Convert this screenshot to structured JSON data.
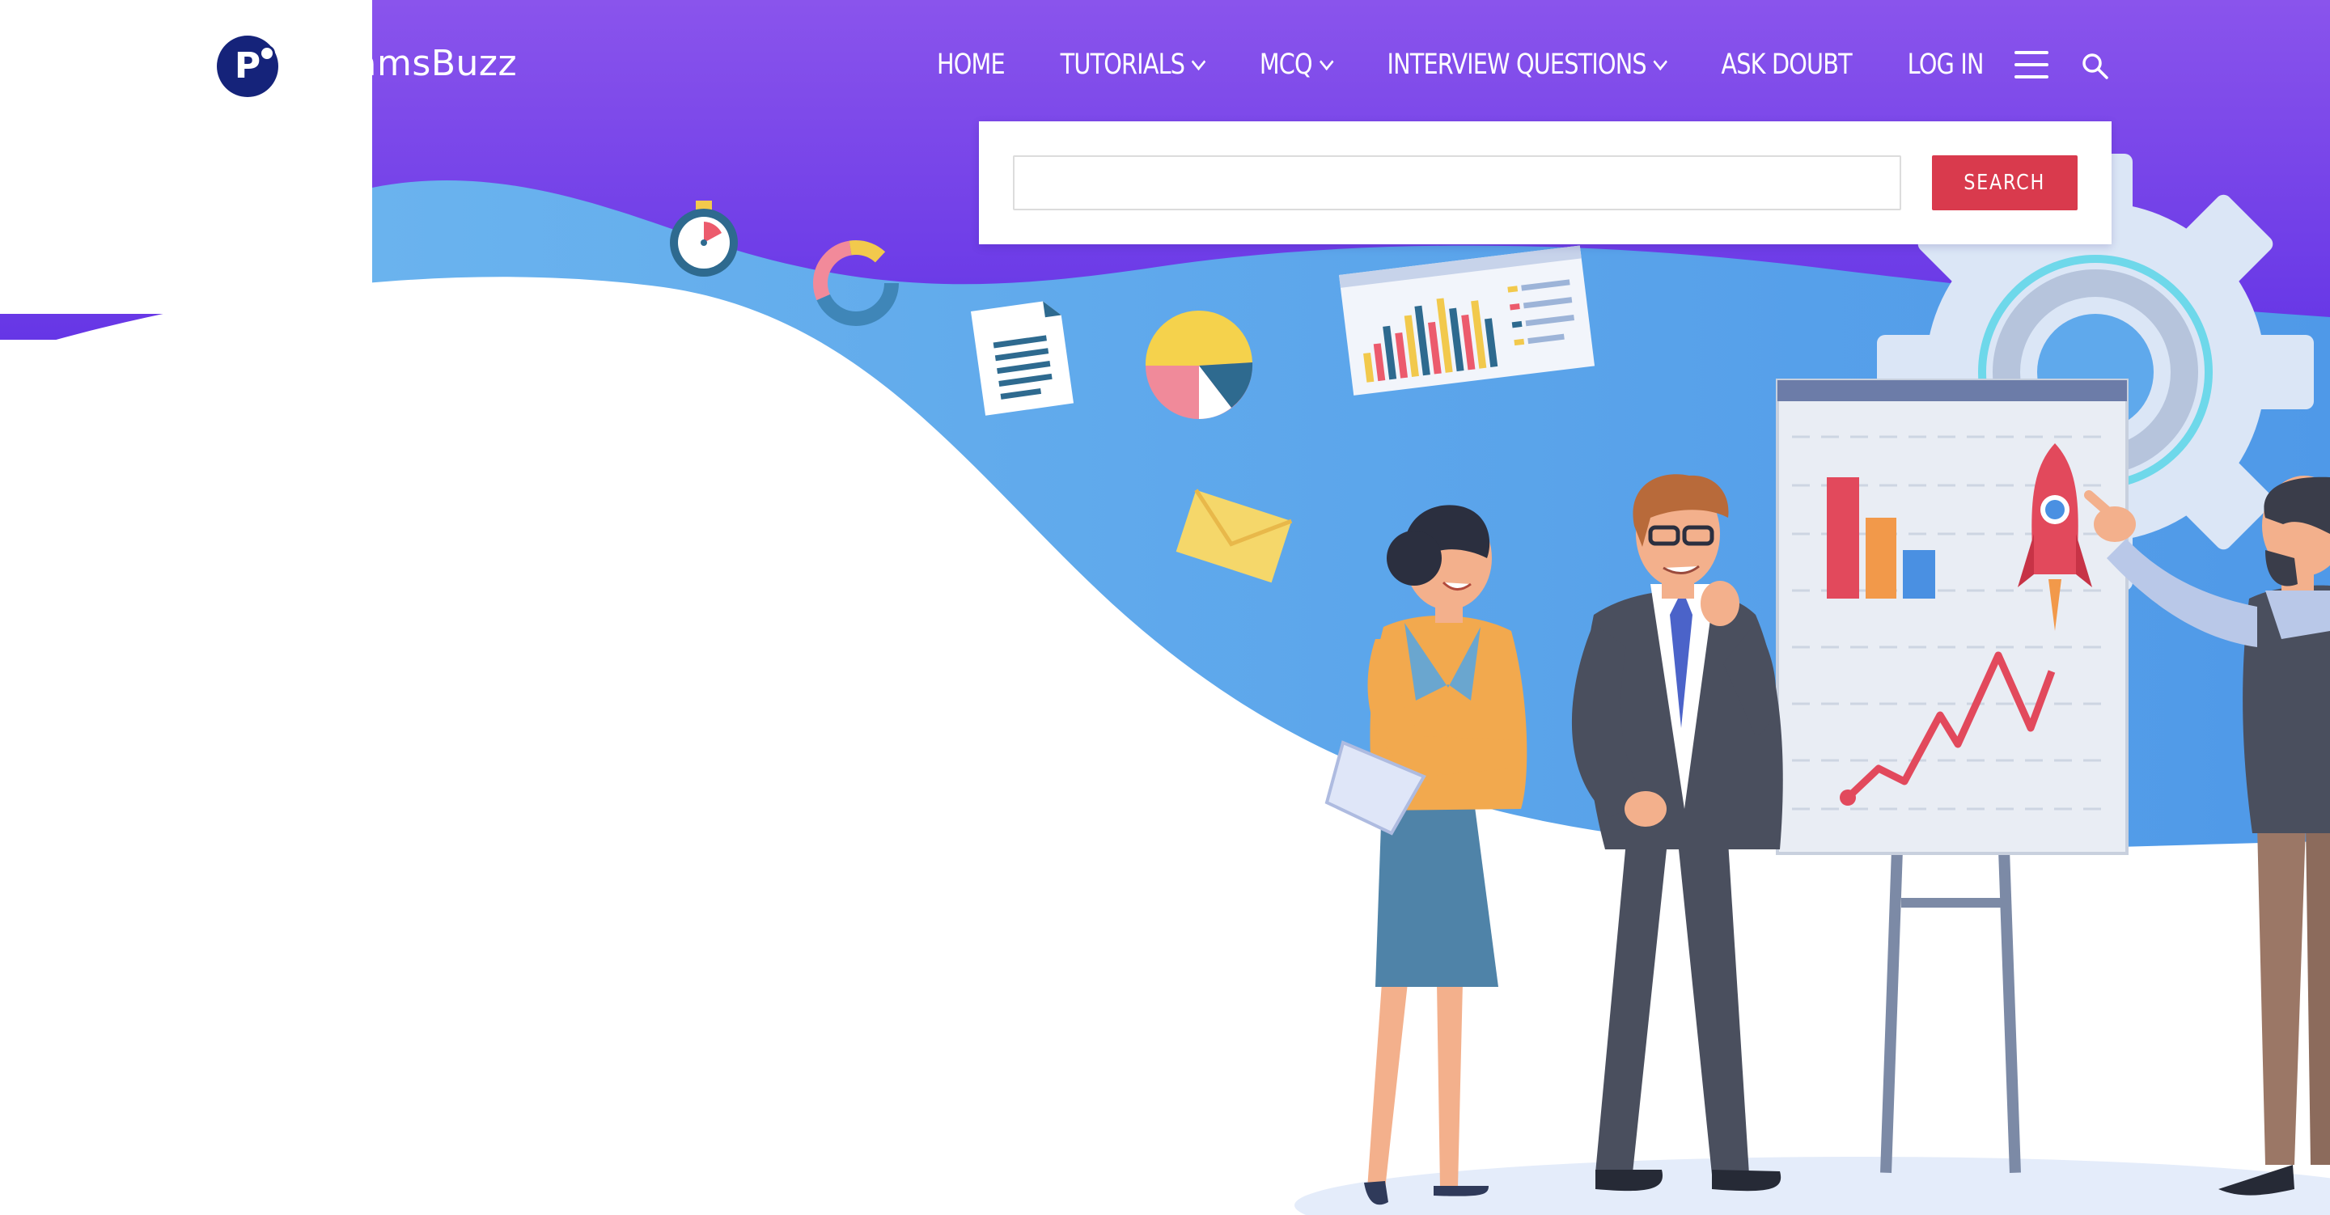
{
  "brand": {
    "logo_letter": "P",
    "logo_text": "ramsBuzz"
  },
  "nav": {
    "items": [
      {
        "label": "HOME",
        "has_dropdown": false
      },
      {
        "label": "TUTORIALS",
        "has_dropdown": true
      },
      {
        "label": "MCQ",
        "has_dropdown": true
      },
      {
        "label": "INTERVIEW QUESTIONS",
        "has_dropdown": true
      },
      {
        "label": "ASK DOUBT",
        "has_dropdown": false
      },
      {
        "label": "LOG IN",
        "has_dropdown": false
      }
    ],
    "menu_icon": "hamburger-menu-icon",
    "search_icon": "search-icon"
  },
  "search": {
    "value": "",
    "placeholder": "",
    "button_label": "SEARCH"
  },
  "colors": {
    "header_gradient_top": "#8a54ec",
    "header_gradient_bottom": "#6c38e8",
    "wave_blue": "#5fa9ec",
    "search_button": "#d93a4d",
    "logo_badge": "#15237a"
  }
}
